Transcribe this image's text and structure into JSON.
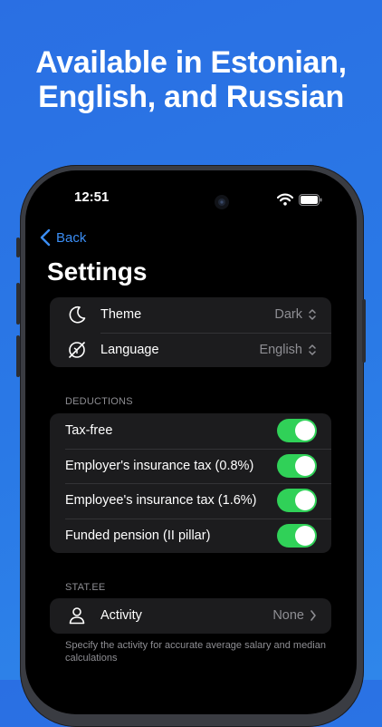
{
  "headline": {
    "line1": "Available in Estonian,",
    "line2": "English, and Russian"
  },
  "status_bar": {
    "time": "12:51"
  },
  "nav": {
    "back_label": "Back"
  },
  "page": {
    "title": "Settings"
  },
  "general": [
    {
      "icon": "moon-icon",
      "label": "Theme",
      "value": "Dark"
    },
    {
      "icon": "globe-slash-icon",
      "label": "Language",
      "value": "English"
    }
  ],
  "deductions": {
    "header": "DEDUCTIONS",
    "items": [
      {
        "label": "Tax-free",
        "on": true
      },
      {
        "label": "Employer's insurance tax (0.8%)",
        "on": true
      },
      {
        "label": "Employee's insurance tax (1.6%)",
        "on": true
      },
      {
        "label": "Funded pension (II pillar)",
        "on": true
      }
    ]
  },
  "stat": {
    "header": "STAT.EE",
    "activity_label": "Activity",
    "activity_value": "None",
    "footnote": "Specify the activity for accurate average salary and median calculations"
  },
  "colors": {
    "accent": "#3b8ef5",
    "toggle_on": "#30d158",
    "background_gradient": "#2a6fe3"
  }
}
